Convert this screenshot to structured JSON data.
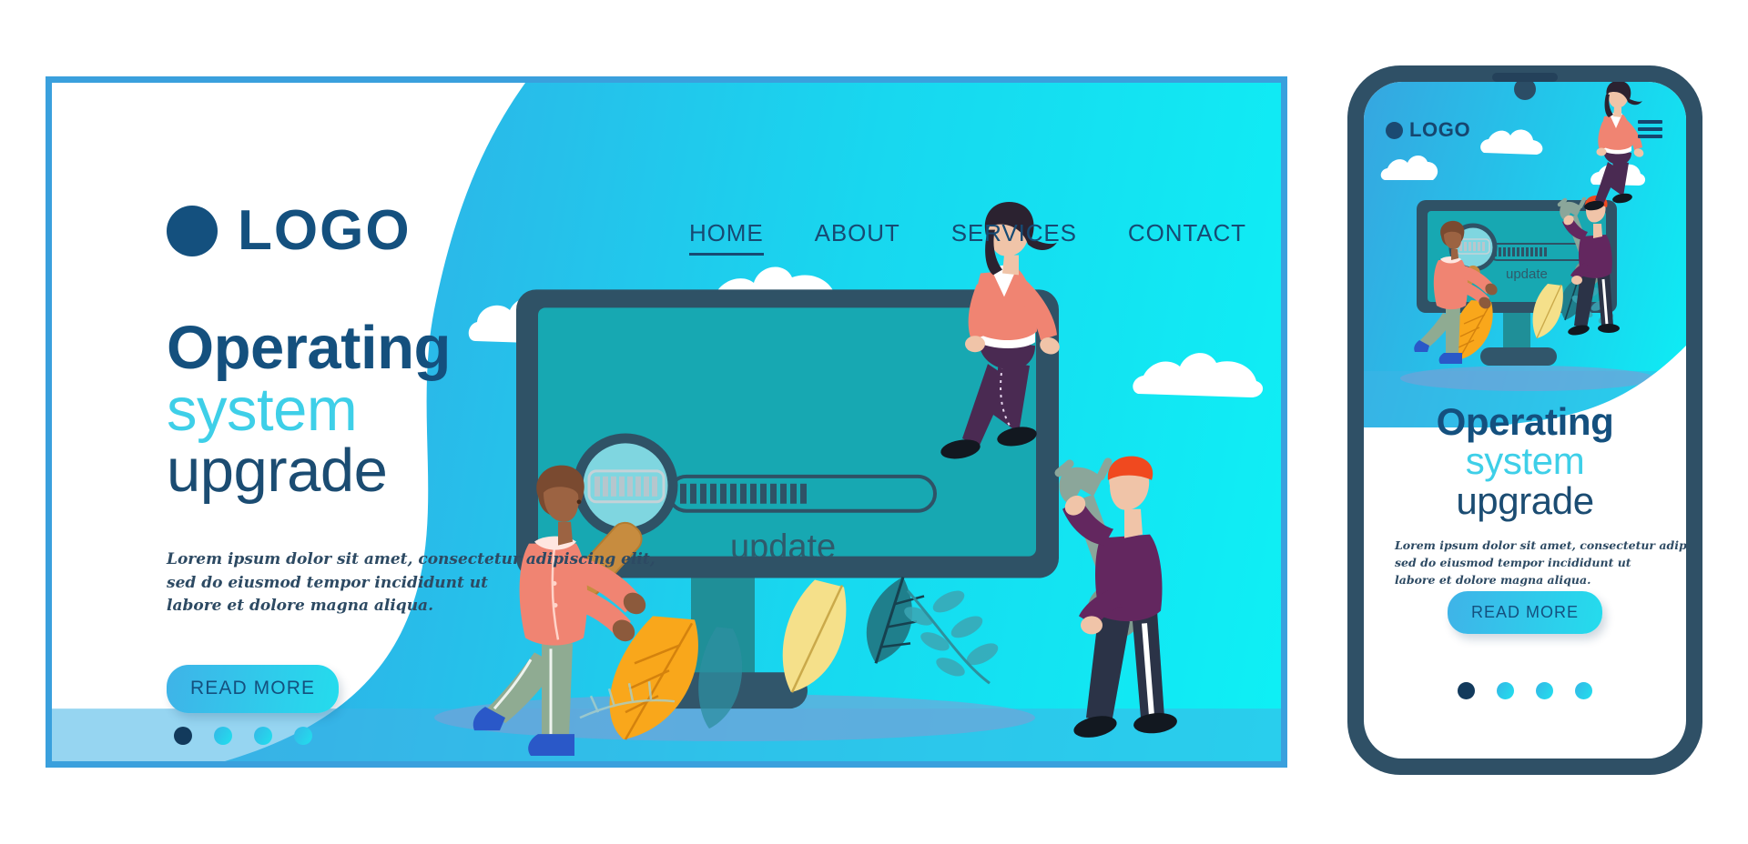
{
  "brand": {
    "name": "LOGO",
    "dot_color": "#14507e",
    "text_color": "#14507e"
  },
  "nav": {
    "items": [
      {
        "label": "HOME",
        "active": true
      },
      {
        "label": "ABOUT",
        "active": false
      },
      {
        "label": "SERVICES",
        "active": false
      },
      {
        "label": "CONTACT",
        "active": false
      }
    ],
    "menu_icon": "hamburger-icon"
  },
  "hero": {
    "headline_line1": "Operating",
    "headline_line2": "system",
    "headline_line3": "upgrade",
    "lead_line1": "Lorem ipsum dolor sit amet, consectetur adipiscing elit,",
    "lead_line2": "sed do eiusmod tempor incididunt ut",
    "lead_line3": "labore et dolore magna aliqua.",
    "cta_label": "READ MORE",
    "dots_total": 4,
    "dot_active_index": 0
  },
  "illustration": {
    "screen_label": "update",
    "progress_percent": 40,
    "progress_segments_filled": 13,
    "progress_segments_total": 32,
    "magnifier_icon": "magnifier-icon",
    "wrench_icon": "wrench-icon"
  },
  "phone": {
    "brand_name": "LOGO",
    "menu_icon": "hamburger-icon",
    "headline_line1": "Operating",
    "headline_line2": "system",
    "headline_line3": "upgrade",
    "lead_line1": "Lorem ipsum dolor sit amet, consectetur adipiscing elit,",
    "lead_line2": "sed do eiusmod tempor incididunt ut",
    "lead_line3": "labore et dolore magna aliqua.",
    "cta_label": "READ MORE",
    "screen_label": "update",
    "dots_total": 4,
    "dot_active_index": 0
  },
  "colors": {
    "brand_navy": "#14507e",
    "accent_cyan": "#3ecfe8",
    "sky_start": "#34a8e0",
    "sky_end": "#0ef0f5",
    "frame_blue": "#3aa0dd",
    "monitor_frame": "#2f5266",
    "monitor_screen": "#17a8b2",
    "phone_body": "#2f5066"
  }
}
